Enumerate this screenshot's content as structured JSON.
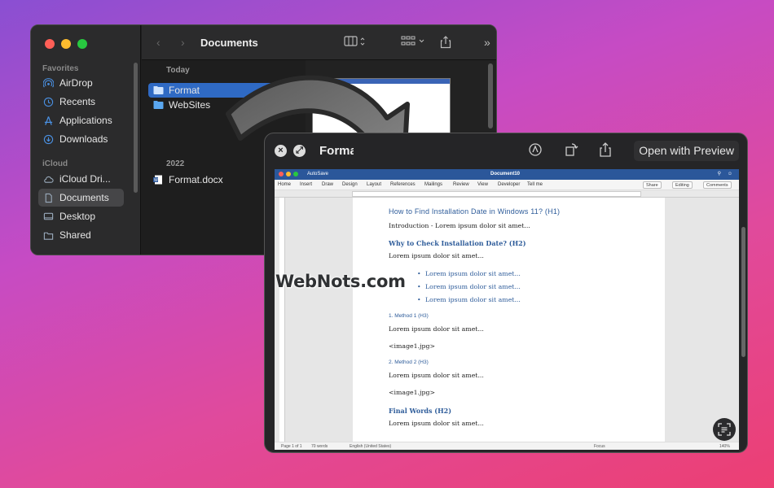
{
  "finder": {
    "title": "Documents",
    "sidebar": {
      "favorites_label": "Favorites",
      "icloud_label": "iCloud",
      "items": [
        {
          "label": "AirDrop"
        },
        {
          "label": "Recents"
        },
        {
          "label": "Applications"
        },
        {
          "label": "Downloads"
        },
        {
          "label": "iCloud Dri..."
        },
        {
          "label": "Documents"
        },
        {
          "label": "Desktop"
        },
        {
          "label": "Shared"
        }
      ]
    },
    "groups": [
      {
        "label": "Today",
        "files": [
          "Format",
          "WebSites"
        ]
      },
      {
        "label": "2022",
        "files": [
          "Format.docx"
        ]
      }
    ]
  },
  "quicklook": {
    "title": "Format",
    "open_button": "Open with Preview"
  },
  "word": {
    "autosave": "AutoSave",
    "doc_title": "Document10",
    "menu": [
      "Home",
      "Insert",
      "Draw",
      "Design",
      "Layout",
      "References",
      "Mailings",
      "Review",
      "View",
      "Developer",
      "Tell me"
    ],
    "actions": [
      "Share",
      "Editing",
      "Comments"
    ],
    "status": {
      "page": "Page 1 of 1",
      "words": "70 words",
      "lang": "English (United States)",
      "focus": "Focus",
      "zoom": "140%"
    },
    "content": {
      "h1": "How to Find Installation Date in Windows 11? (H1)",
      "intro": "Introduction - Lorem ipsum dolor sit amet...",
      "h2a": "Why to Check Installation Date? (H2)",
      "p1": "Lorem ipsum dolor sit amet...",
      "bullets": [
        "Lorem ipsum dolor sit amet...",
        "Lorem ipsum dolor sit amet...",
        "Lorem ipsum dolor sit amet..."
      ],
      "h3a": "1. Method 1 (H3)",
      "p2": "Lorem ipsum dolor sit amet...",
      "img1": "<image1.jpg>",
      "h3b": "2. Method 2 (H3)",
      "p3": "Lorem ipsum dolor sit amet...",
      "img2": "<image1.jpg>",
      "h2b": "Final Words (H2)",
      "p4": "Lorem ipsum dolor sit amet..."
    }
  },
  "watermark": "WebNots.com",
  "colors": {
    "selection": "#2f6ac4",
    "word_blue": "#2b579a",
    "heading_blue": "#2e5c9a"
  }
}
